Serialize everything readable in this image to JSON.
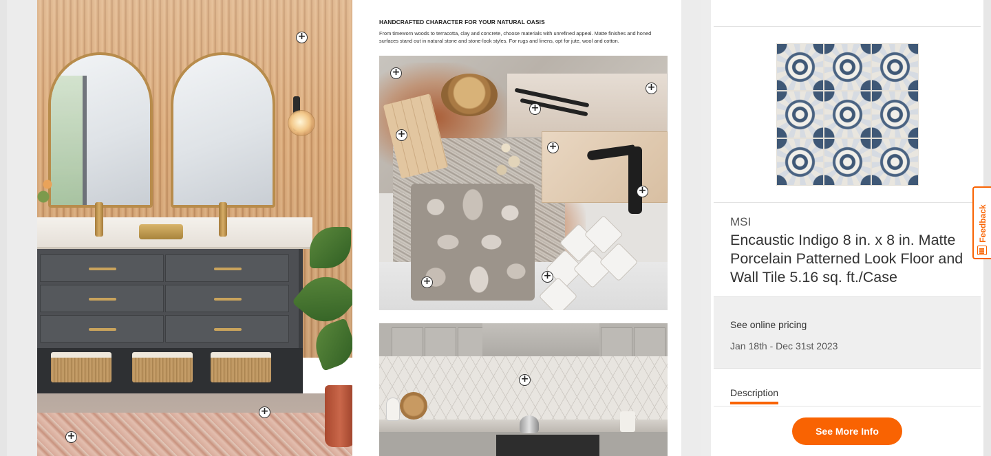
{
  "flyer": {
    "headline": "HANDCRAFTED CHARACTER FOR YOUR NATURAL OASIS",
    "body": "From timeworn woods to terracotta, clay and concrete, choose materials with unrefined appeal. Matte finishes and honed surfaces stand out in natural stone and stone-look styles. For rugs and linens, opt for jute, wool and cotton.",
    "hotspot_symbol": "+"
  },
  "product": {
    "brand": "MSI",
    "title": "Encaustic Indigo 8 in. x 8 in. Matte Porcelain Patterned Look Floor and Wall Tile 5.16 sq. ft./Case",
    "price_text": "See online pricing",
    "dates": "Jan 18th - Dec 31st 2023",
    "tab_description": "Description",
    "cta_label": "See More Info"
  },
  "feedback": {
    "label": "Feedback",
    "icon": "feedback-form-icon"
  },
  "colors": {
    "accent": "#f96302",
    "tile_blue": "#3f5876"
  }
}
